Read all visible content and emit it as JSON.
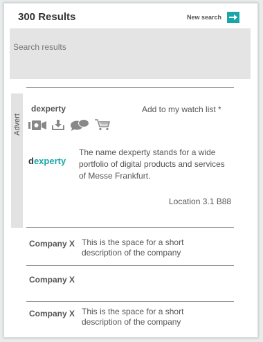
{
  "header": {
    "results_title": "300 Results",
    "new_search_label": "New search"
  },
  "search": {
    "placeholder": "Search results"
  },
  "advert": {
    "tab_label": "Advert",
    "company": "dexperty",
    "watch_label": "Add to my watch list *",
    "icons": [
      "video-icon",
      "download-icon",
      "chat-icon",
      "cart-icon"
    ],
    "logo_initial": "d",
    "logo_rest": "experty",
    "description": "The name dexperty stands for a wide portfolio of digital products and services of Messe Frankfurt.",
    "location": "Location 3.1 B88"
  },
  "results": [
    {
      "name": "Company X",
      "description": "This is the space for a short description of the company"
    },
    {
      "name": "Company X",
      "description": ""
    },
    {
      "name": "Company X",
      "description": "This is the space for a short description of the company"
    }
  ],
  "colors": {
    "accent": "#1aa6a8",
    "search_bg": "#e4e4e4",
    "text": "#555555"
  }
}
